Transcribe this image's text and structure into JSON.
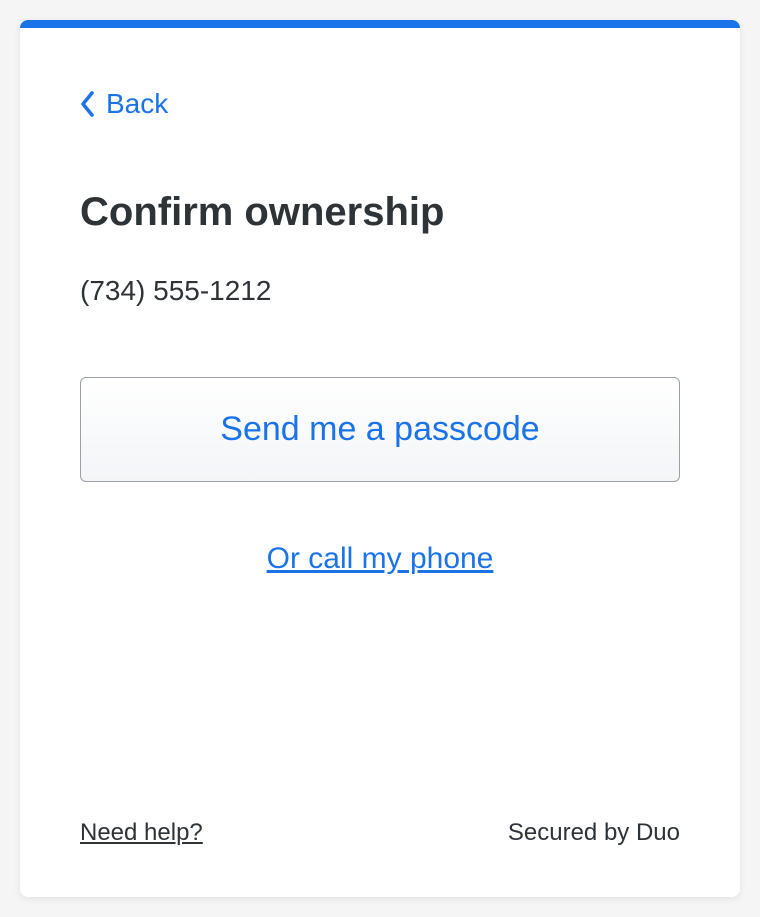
{
  "colors": {
    "accent": "#1a73e8",
    "text": "#2e3338"
  },
  "back": {
    "label": "Back"
  },
  "header": {
    "title": "Confirm ownership",
    "phone": "(734) 555-1212"
  },
  "actions": {
    "send_passcode_label": "Send me a passcode",
    "call_phone_label": "Or call my phone"
  },
  "footer": {
    "help_label": "Need help?",
    "secured_label": "Secured by Duo"
  }
}
